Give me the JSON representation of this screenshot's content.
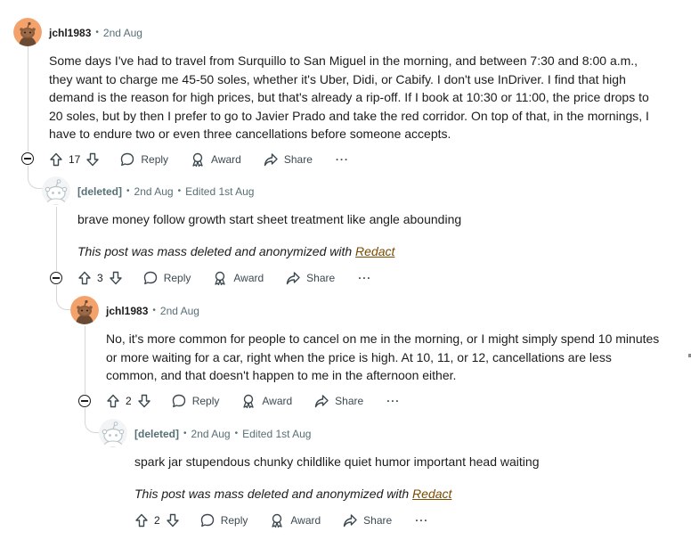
{
  "labels": {
    "reply": "Reply",
    "award": "Award",
    "share": "Share",
    "more": "···",
    "dot": "•",
    "redact_prefix": "This post was mass deleted and anonymized with ",
    "redact_link": "Redact"
  },
  "colors": {
    "avatar_orange": "#f4a26c",
    "link": "#7a4b00",
    "meta": "#576f76"
  },
  "comments": [
    {
      "author": "jchl1983",
      "time": "2nd Aug",
      "body": "Some days I've had to travel from Surquillo to San Miguel in the morning, and between 7:30 and 8:00 a.m., they want to charge me 45-50 soles, whether it's Uber, Didi, or Cabify. I don't use InDriver. I find that high demand is the reason for high prices, but that's already a rip-off. If I book at 10:30 or 11:00, the price drops to 20 soles, but by then I prefer to go to Javier Prado and take the red corridor. On top of that, in the mornings, I have to endure two or even three cancellations before someone accepts.",
      "votes": "17"
    },
    {
      "author": "[deleted]",
      "time": "2nd Aug",
      "edited": "Edited 1st Aug",
      "body": "brave money follow growth start sheet treatment like angle abounding",
      "votes": "3"
    },
    {
      "author": "jchl1983",
      "time": "2nd Aug",
      "body": "No, it's more common for people to cancel on me in the morning, or I might simply spend 10 minutes or more waiting for a car, right when the price is high. At 10, 11, or 12, cancellations are less common, and that doesn't happen to me in the afternoon either.",
      "votes": "2"
    },
    {
      "author": "[deleted]",
      "time": "2nd Aug",
      "edited": "Edited 1st Aug",
      "body": "spark jar stupendous chunky childlike quiet humor important head waiting",
      "votes": "2"
    }
  ]
}
